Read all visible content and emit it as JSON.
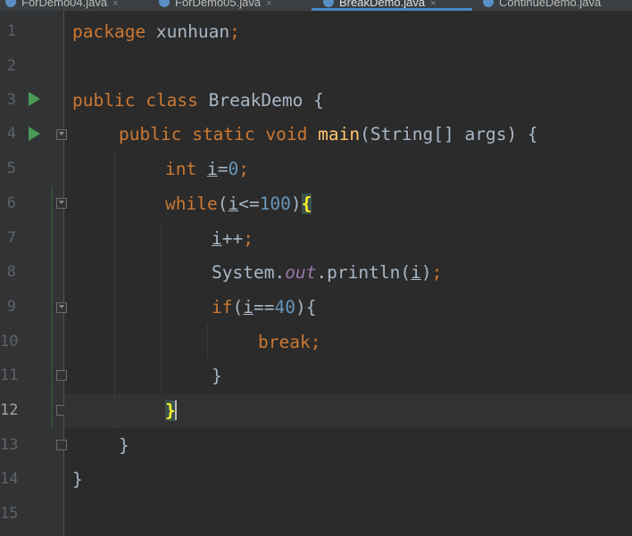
{
  "tabs": [
    {
      "label": "ForDemo04.java",
      "close": "×",
      "active": false
    },
    {
      "label": "ForDemo05.java",
      "close": "×",
      "active": false
    },
    {
      "label": "BreakDemo.java",
      "close": "×",
      "active": true
    },
    {
      "label": "ContinueDemo.java",
      "close": "×",
      "active": false
    }
  ],
  "gutter": {
    "line_numbers": [
      "1",
      "2",
      "3",
      "4",
      "5",
      "6",
      "7",
      "8",
      "9",
      "10",
      "11",
      "12",
      "13",
      "14",
      "15"
    ],
    "current_line": 12
  },
  "code": {
    "line1": {
      "kw": "package",
      "rest": " xunhuan",
      "semi": ";"
    },
    "line3": {
      "kw1": "public",
      "kw2": "class",
      "name": "BreakDemo",
      "brace": "{"
    },
    "line4": {
      "kw1": "public",
      "kw2": "static",
      "kw3": "void",
      "method": "main",
      "params": "(String[] args) {"
    },
    "line5": {
      "kw": "int",
      "var": "i",
      "eq": "=",
      "num": "0",
      "semi": ";"
    },
    "line6": {
      "kw": "while",
      "open": "(",
      "var": "i",
      "op": "<=",
      "num": "100",
      "close": ")",
      "brace": "{"
    },
    "line7": {
      "var": "i",
      "op": "++",
      "semi": ";"
    },
    "line8": {
      "cls": "System.",
      "field": "out",
      "call": ".println(",
      "var": "i",
      "close": ")",
      "semi": ";"
    },
    "line9": {
      "kw": "if",
      "open": "(",
      "var": "i",
      "op": "==",
      "num": "40",
      "close": "){"
    },
    "line10": {
      "kw": "break",
      "semi": ";"
    },
    "line11": {
      "brace": "}"
    },
    "line12": {
      "brace": "}"
    },
    "line13": {
      "brace": "}"
    },
    "line14": {
      "brace": "}"
    }
  }
}
